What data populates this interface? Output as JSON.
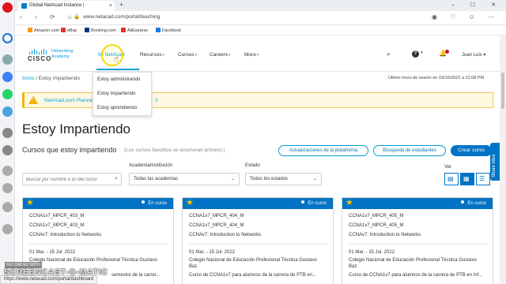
{
  "browser": {
    "tab_title": "Global NetAcad Instance |",
    "tab_close": "×",
    "new_tab": "+",
    "url": "www.netacad.com/portal/teaching",
    "lock_glyph": "🔒",
    "nav_glyphs": "‹ › ⟳ ⌂",
    "window_controls": "‒ ☐ ✕",
    "right_glyphs": "◉ ♡ ☺ ⋯",
    "bookmarks": [
      {
        "label": "Amazon.com",
        "color": "#f90"
      },
      {
        "label": "eBay",
        "color": "#e53238"
      },
      {
        "label": "Booking.com",
        "color": "#003580"
      },
      {
        "label": "AliExpress",
        "color": "#e43225"
      },
      {
        "label": "Facebook",
        "color": "#1877f2"
      }
    ],
    "status_url": "https://www.netacad.com/portal/dashboard"
  },
  "header": {
    "cisco": "CISCO",
    "brand": "Networking Academy",
    "nav": [
      {
        "label": "Mi NetAcad",
        "chev": "",
        "active": true
      },
      {
        "label": "Recursos",
        "chev": "▾",
        "active": false
      },
      {
        "label": "Cursos",
        "chev": "▾",
        "active": false
      },
      {
        "label": "Careers",
        "chev": "▾",
        "active": false
      },
      {
        "label": "More",
        "chev": "▾",
        "active": false
      }
    ],
    "help_glyph": "?",
    "search_glyph": "⌕",
    "bell_glyph": "🔔",
    "chev": "▾",
    "user": "Juan Luis ▾"
  },
  "dropdown": {
    "items": [
      "Estoy administrando",
      "Estoy Impartiendo",
      "Estoy aprendiendo"
    ]
  },
  "breadcrumb": {
    "home": "Inicio",
    "separator": " / ",
    "current": "Estoy Impartiendo"
  },
  "last_login": "Último inicio de sesión en 03/16/2022 a 22:08 PM",
  "banner": {
    "text_before": "NetAcad.com Planne",
    "text_after": "2"
  },
  "page": {
    "title": "Estoy Impartiendo",
    "section_title": "Cursos que estoy impartiendo",
    "section_note": "(Los cursos favoritos se enumeran primero.)",
    "buttons": {
      "platform_updates": "Actualizaciones de la plataforma",
      "student_search": "Búsqueda de estudiantes",
      "create_course": "Crear curso"
    },
    "share_tab": "Share Idea"
  },
  "filters": {
    "search_placeholder": "Buscar por nombre o ID del curso",
    "academy_label": "Academia/institución",
    "academy_value": "Todas las academias",
    "status_label": "Estado",
    "status_value": "Todos los estados",
    "view_label": "Ver"
  },
  "cards": [
    {
      "status": "En curso",
      "code": "CCNA1v7_MPCR_403_M",
      "name": "CCNA1v7_MPCR_403_M",
      "course": "CCNAv7: Introduction to Networks",
      "dates": "01 Mar. - 15 Jul. 2022",
      "institution": "Colegio Nacional de Educación Profesional Técnica Gustavo",
      "extra": "semestre de la carrer..."
    },
    {
      "status": "En curso",
      "code": "CCNA1v7_MPCR_404_M",
      "name": "CCNA1v7_MPCR_404_M",
      "course": "CCNAv7: Introduction to Networks",
      "dates": "01 Mar. - 15 Jul. 2022",
      "institution": "Colegio Nacional de Educación Profesional Técnica Gustavo",
      "institution2": "Baz",
      "extra": "Curso de CCNA1v7 para alumnos de la carrera de PTB en..."
    },
    {
      "status": "En curso",
      "code": "CCNA1v7_MPCR_405_M",
      "name": "CCNA1v7_MPCR_405_M",
      "course": "CCNAv7: Introduction to Networks",
      "dates": "01 Mar. - 15 Jul. 2022",
      "institution": "Colegio Nacional de Educación Profesional Técnica Gustavo",
      "institution2": "Baz",
      "extra": "Curso de CCNA1v7 para alumnos de la carrera de PTB en Inf..."
    }
  ],
  "icons": {
    "star": "★",
    "search": "⌕",
    "chevron": "⌄",
    "view_list_alt": "▤",
    "view_grid": "▦",
    "view_list": "☰",
    "pointer": "☝"
  },
  "overlay": {
    "recorded_with": "RECORDED WITH",
    "watermark": "SCREENCAST-O-MATIC"
  },
  "colors": {
    "accent": "#049fd9",
    "primary": "#0073c6",
    "star": "#f5c400",
    "warning": "#f0b400"
  }
}
